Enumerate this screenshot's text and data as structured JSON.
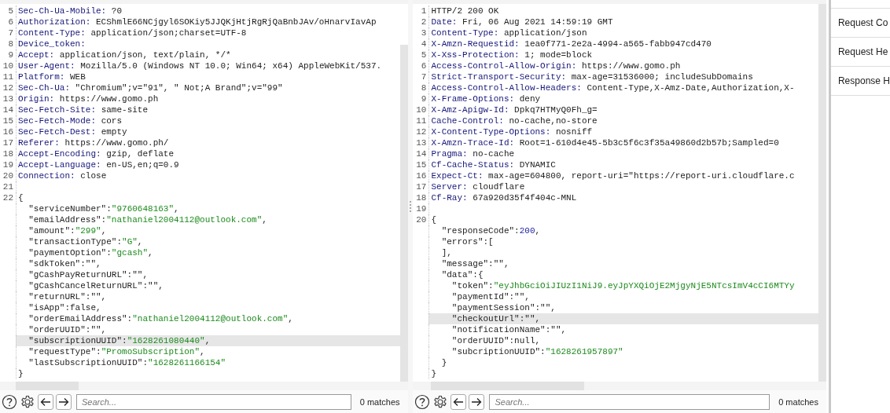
{
  "request": {
    "lines": [
      {
        "number": "5",
        "highlighted": false,
        "segments": [
          {
            "kind": "header",
            "text": "Sec-Ch-Ua-Mobile:"
          },
          {
            "kind": "text",
            "text": " ?0"
          }
        ]
      },
      {
        "number": "6",
        "highlighted": false,
        "segments": [
          {
            "kind": "header",
            "text": "Authorization:"
          },
          {
            "kind": "text",
            "text": " ECShmlE66NCjgyl6SOKiy5JJQKjHtjRgRjQaBnbJAv/oHnarvIavAp"
          }
        ]
      },
      {
        "number": "7",
        "highlighted": false,
        "segments": [
          {
            "kind": "header",
            "text": "Content-Type:"
          },
          {
            "kind": "text",
            "text": " application/json;charset=UTF-8"
          }
        ]
      },
      {
        "number": "8",
        "highlighted": false,
        "segments": [
          {
            "kind": "header",
            "text": "Device_token:"
          }
        ]
      },
      {
        "number": "9",
        "highlighted": false,
        "segments": [
          {
            "kind": "header",
            "text": "Accept:"
          },
          {
            "kind": "text",
            "text": " application/json, text/plain, */*"
          }
        ]
      },
      {
        "number": "10",
        "highlighted": false,
        "segments": [
          {
            "kind": "header",
            "text": "User-Agent:"
          },
          {
            "kind": "text",
            "text": " Mozilla/5.0 (Windows NT 10.0; Win64; x64) AppleWebKit/537."
          }
        ]
      },
      {
        "number": "11",
        "highlighted": false,
        "segments": [
          {
            "kind": "header",
            "text": "Platform:"
          },
          {
            "kind": "text",
            "text": " WEB"
          }
        ]
      },
      {
        "number": "12",
        "highlighted": false,
        "segments": [
          {
            "kind": "header",
            "text": "Sec-Ch-Ua:"
          },
          {
            "kind": "text",
            "text": " \"Chromium\";v=\"91\", \" Not;A Brand\";v=\"99\""
          }
        ]
      },
      {
        "number": "13",
        "highlighted": false,
        "segments": [
          {
            "kind": "header",
            "text": "Origin:"
          },
          {
            "kind": "text",
            "text": " https://www.gomo.ph"
          }
        ]
      },
      {
        "number": "14",
        "highlighted": false,
        "segments": [
          {
            "kind": "header",
            "text": "Sec-Fetch-Site:"
          },
          {
            "kind": "text",
            "text": " same-site"
          }
        ]
      },
      {
        "number": "15",
        "highlighted": false,
        "segments": [
          {
            "kind": "header",
            "text": "Sec-Fetch-Mode:"
          },
          {
            "kind": "text",
            "text": " cors"
          }
        ]
      },
      {
        "number": "16",
        "highlighted": false,
        "segments": [
          {
            "kind": "header",
            "text": "Sec-Fetch-Dest:"
          },
          {
            "kind": "text",
            "text": " empty"
          }
        ]
      },
      {
        "number": "17",
        "highlighted": false,
        "segments": [
          {
            "kind": "header",
            "text": "Referer:"
          },
          {
            "kind": "text",
            "text": " https://www.gomo.ph/"
          }
        ]
      },
      {
        "number": "18",
        "highlighted": false,
        "segments": [
          {
            "kind": "header",
            "text": "Accept-Encoding:"
          },
          {
            "kind": "text",
            "text": " gzip, deflate"
          }
        ]
      },
      {
        "number": "19",
        "highlighted": false,
        "segments": [
          {
            "kind": "header",
            "text": "Accept-Language:"
          },
          {
            "kind": "text",
            "text": " en-US,en;q=0.9"
          }
        ]
      },
      {
        "number": "20",
        "highlighted": false,
        "segments": [
          {
            "kind": "header",
            "text": "Connection:"
          },
          {
            "kind": "text",
            "text": " close"
          }
        ]
      },
      {
        "number": "21",
        "highlighted": false
      },
      {
        "number": "22",
        "highlighted": false,
        "segments": [
          {
            "kind": "text",
            "text": "{"
          }
        ]
      },
      {
        "highlighted": false,
        "segments": [
          {
            "kind": "text",
            "text": "  \"serviceNumber\":"
          },
          {
            "kind": "string",
            "text": "\"9760648163\""
          },
          {
            "kind": "text",
            "text": ","
          }
        ]
      },
      {
        "highlighted": false,
        "segments": [
          {
            "kind": "text",
            "text": "  \"emailAddress\":"
          },
          {
            "kind": "string",
            "text": "\"nathaniel2004112@outlook.com\""
          },
          {
            "kind": "text",
            "text": ","
          }
        ]
      },
      {
        "highlighted": false,
        "segments": [
          {
            "kind": "text",
            "text": "  \"amount\":"
          },
          {
            "kind": "string",
            "text": "\"299\""
          },
          {
            "kind": "text",
            "text": ","
          }
        ]
      },
      {
        "highlighted": false,
        "segments": [
          {
            "kind": "text",
            "text": "  \"transactionType\":"
          },
          {
            "kind": "string",
            "text": "\"G\""
          },
          {
            "kind": "text",
            "text": ","
          }
        ]
      },
      {
        "highlighted": false,
        "segments": [
          {
            "kind": "text",
            "text": "  \"paymentOption\":"
          },
          {
            "kind": "string",
            "text": "\"gcash\""
          },
          {
            "kind": "text",
            "text": ","
          }
        ]
      },
      {
        "highlighted": false,
        "segments": [
          {
            "kind": "text",
            "text": "  \"sdkToken\":\"\","
          }
        ]
      },
      {
        "highlighted": false,
        "segments": [
          {
            "kind": "text",
            "text": "  \"gCashPayReturnURL\":\"\","
          }
        ]
      },
      {
        "highlighted": false,
        "segments": [
          {
            "kind": "text",
            "text": "  \"gCashCancelReturnURL\":\"\","
          }
        ]
      },
      {
        "highlighted": false,
        "segments": [
          {
            "kind": "text",
            "text": "  \"returnURL\":\"\","
          }
        ]
      },
      {
        "highlighted": false,
        "segments": [
          {
            "kind": "text",
            "text": "  \"isApp\":false,"
          }
        ]
      },
      {
        "highlighted": false,
        "segments": [
          {
            "kind": "text",
            "text": "  \"orderEmailAddress\":"
          },
          {
            "kind": "string",
            "text": "\"nathaniel2004112@outlook.com\""
          },
          {
            "kind": "text",
            "text": ","
          }
        ]
      },
      {
        "highlighted": false,
        "segments": [
          {
            "kind": "text",
            "text": "  \"orderUUID\":\"\","
          }
        ]
      },
      {
        "highlighted": true,
        "segments": [
          {
            "kind": "text",
            "text": "  \"subscriptionUUID\":"
          },
          {
            "kind": "string",
            "text": "\"1628261080440\""
          },
          {
            "kind": "text",
            "text": ","
          }
        ]
      },
      {
        "highlighted": false,
        "segments": [
          {
            "kind": "text",
            "text": "  \"requestType\":"
          },
          {
            "kind": "string",
            "text": "\"PromoSubscription\""
          },
          {
            "kind": "text",
            "text": ","
          }
        ]
      },
      {
        "highlighted": false,
        "segments": [
          {
            "kind": "text",
            "text": "  \"lastSubscriptionUUID\":"
          },
          {
            "kind": "string",
            "text": "\"1628261166154\""
          }
        ]
      },
      {
        "highlighted": false,
        "segments": [
          {
            "kind": "text",
            "text": "}"
          }
        ]
      }
    ],
    "search": {
      "placeholder": "Search..."
    },
    "matches": "0 matches"
  },
  "response": {
    "lines": [
      {
        "number": "1",
        "highlighted": false,
        "segments": [
          {
            "kind": "text",
            "text": "HTTP/2 200 OK"
          }
        ]
      },
      {
        "number": "2",
        "highlighted": false,
        "segments": [
          {
            "kind": "header",
            "text": "Date:"
          },
          {
            "kind": "text",
            "text": " Fri, 06 Aug 2021 14:59:19 GMT"
          }
        ]
      },
      {
        "number": "3",
        "highlighted": false,
        "segments": [
          {
            "kind": "header",
            "text": "Content-Type:"
          },
          {
            "kind": "text",
            "text": " application/json"
          }
        ]
      },
      {
        "number": "4",
        "highlighted": false,
        "segments": [
          {
            "kind": "header",
            "text": "X-Amzn-Requestid:"
          },
          {
            "kind": "text",
            "text": " 1ea0f771-2e2a-4994-a565-fabb947cd470"
          }
        ]
      },
      {
        "number": "5",
        "highlighted": false,
        "segments": [
          {
            "kind": "header",
            "text": "X-Xss-Protection:"
          },
          {
            "kind": "text",
            "text": " 1; mode=block"
          }
        ]
      },
      {
        "number": "6",
        "highlighted": false,
        "segments": [
          {
            "kind": "header",
            "text": "Access-Control-Allow-Origin:"
          },
          {
            "kind": "text",
            "text": " https://www.gomo.ph"
          }
        ]
      },
      {
        "number": "7",
        "highlighted": false,
        "segments": [
          {
            "kind": "header",
            "text": "Strict-Transport-Security:"
          },
          {
            "kind": "text",
            "text": " max-age=31536000; includeSubDomains"
          }
        ]
      },
      {
        "number": "8",
        "highlighted": false,
        "segments": [
          {
            "kind": "header",
            "text": "Access-Control-Allow-Headers:"
          },
          {
            "kind": "text",
            "text": " Content-Type,X-Amz-Date,Authorization,X-"
          }
        ]
      },
      {
        "number": "9",
        "highlighted": false,
        "segments": [
          {
            "kind": "header",
            "text": "X-Frame-Options:"
          },
          {
            "kind": "text",
            "text": " deny"
          }
        ]
      },
      {
        "number": "10",
        "highlighted": false,
        "segments": [
          {
            "kind": "header",
            "text": "X-Amz-Apigw-Id:"
          },
          {
            "kind": "text",
            "text": " Dpkq7HTMyQ0Fh_g="
          }
        ]
      },
      {
        "number": "11",
        "highlighted": false,
        "segments": [
          {
            "kind": "header",
            "text": "Cache-Control:"
          },
          {
            "kind": "text",
            "text": " no-cache,no-store"
          }
        ]
      },
      {
        "number": "12",
        "highlighted": false,
        "segments": [
          {
            "kind": "header",
            "text": "X-Content-Type-Options:"
          },
          {
            "kind": "text",
            "text": " nosniff"
          }
        ]
      },
      {
        "number": "13",
        "highlighted": false,
        "segments": [
          {
            "kind": "header",
            "text": "X-Amzn-Trace-Id:"
          },
          {
            "kind": "text",
            "text": " Root=1-610d4e45-5b3c5f6c3f35a49860d2b57b;Sampled=0"
          }
        ]
      },
      {
        "number": "14",
        "highlighted": false,
        "segments": [
          {
            "kind": "header",
            "text": "Pragma:"
          },
          {
            "kind": "text",
            "text": " no-cache"
          }
        ]
      },
      {
        "number": "15",
        "highlighted": false,
        "segments": [
          {
            "kind": "header",
            "text": "Cf-Cache-Status:"
          },
          {
            "kind": "text",
            "text": " DYNAMIC"
          }
        ]
      },
      {
        "number": "16",
        "highlighted": false,
        "segments": [
          {
            "kind": "header",
            "text": "Expect-Ct:"
          },
          {
            "kind": "text",
            "text": " max-age=604800, report-uri=\"https://report-uri.cloudflare.c"
          }
        ]
      },
      {
        "number": "17",
        "highlighted": false,
        "segments": [
          {
            "kind": "header",
            "text": "Server:"
          },
          {
            "kind": "text",
            "text": " cloudflare"
          }
        ]
      },
      {
        "number": "18",
        "highlighted": false,
        "segments": [
          {
            "kind": "header",
            "text": "Cf-Ray:"
          },
          {
            "kind": "text",
            "text": " 67a920d35f4f404c-MNL"
          }
        ]
      },
      {
        "number": "19",
        "highlighted": false
      },
      {
        "number": "20",
        "highlighted": false,
        "segments": [
          {
            "kind": "text",
            "text": "{"
          }
        ]
      },
      {
        "highlighted": false,
        "segments": [
          {
            "kind": "text",
            "text": "  \"responseCode\":"
          },
          {
            "kind": "number",
            "text": "200"
          },
          {
            "kind": "text",
            "text": ","
          }
        ]
      },
      {
        "highlighted": false,
        "segments": [
          {
            "kind": "text",
            "text": "  \"errors\":["
          }
        ]
      },
      {
        "highlighted": false,
        "segments": [
          {
            "kind": "text",
            "text": "  ],"
          }
        ]
      },
      {
        "highlighted": false,
        "segments": [
          {
            "kind": "text",
            "text": "  \"message\":\"\","
          }
        ]
      },
      {
        "highlighted": false,
        "segments": [
          {
            "kind": "text",
            "text": "  \"data\":{"
          }
        ]
      },
      {
        "highlighted": false,
        "segments": [
          {
            "kind": "text",
            "text": "    \"token\":"
          },
          {
            "kind": "string",
            "text": "\"eyJhbGciOiJIUzI1NiJ9.eyJpYXQiOjE2MjgyNjE5NTcsImV4cCI6MTYy"
          }
        ]
      },
      {
        "highlighted": false,
        "segments": [
          {
            "kind": "text",
            "text": "    \"paymentId\":\"\","
          }
        ]
      },
      {
        "highlighted": false,
        "segments": [
          {
            "kind": "text",
            "text": "    \"paymentSession\":\"\","
          }
        ]
      },
      {
        "highlighted": true,
        "segments": [
          {
            "kind": "text",
            "text": "    \"checkoutUrl\":\"\","
          }
        ]
      },
      {
        "highlighted": false,
        "segments": [
          {
            "kind": "text",
            "text": "    \"notificationName\":\"\","
          }
        ]
      },
      {
        "highlighted": false,
        "segments": [
          {
            "kind": "text",
            "text": "    \"orderUUID\":null,"
          }
        ]
      },
      {
        "highlighted": false,
        "segments": [
          {
            "kind": "text",
            "text": "    \"subcriptionUUID\":"
          },
          {
            "kind": "string",
            "text": "\"1628261957897\""
          }
        ]
      },
      {
        "highlighted": false,
        "segments": [
          {
            "kind": "text",
            "text": "  }"
          }
        ]
      },
      {
        "highlighted": false,
        "segments": [
          {
            "kind": "text",
            "text": "}"
          }
        ]
      }
    ],
    "search": {
      "placeholder": "Search..."
    },
    "matches": "0 matches"
  },
  "inspector": {
    "sections": [
      "Request Co",
      "Request He",
      "Response H"
    ]
  }
}
